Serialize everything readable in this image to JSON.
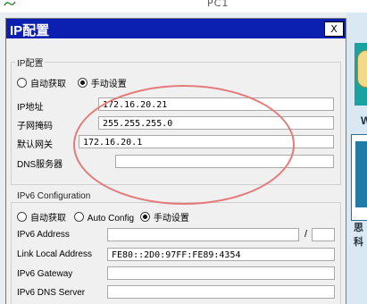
{
  "window": {
    "title": "PC1"
  },
  "dialog": {
    "title": "IP配置",
    "close_label": "X"
  },
  "ipv4": {
    "group_title": "IP配置",
    "modes": [
      "自动获取",
      "手动设置"
    ],
    "selected_mode": "手动设置",
    "fields": [
      {
        "label": "IP地址",
        "value": "172.16.20.21"
      },
      {
        "label": "子网掩码",
        "value": "255.255.255.0"
      },
      {
        "label": "默认网关",
        "value": "172.16.20.1"
      },
      {
        "label": "DNS服务器",
        "value": ""
      }
    ]
  },
  "ipv6": {
    "group_title": "IPv6 Configuration",
    "modes": [
      "自动获取",
      "Auto Config",
      "手动设置"
    ],
    "selected_mode": "手动设置",
    "address": {
      "label": "IPv6 Address",
      "value": "",
      "prefix": ""
    },
    "prefix_separator": "/",
    "link_local": {
      "label": "Link Local Address",
      "value": "FE80::2D0:97FF:FE89:4354"
    },
    "gateway": {
      "label": "IPv6 Gateway",
      "value": ""
    },
    "dns": {
      "label": "IPv6 DNS Server",
      "value": ""
    }
  },
  "background": {
    "right_letter": "W",
    "right_text": "思科"
  },
  "colors": {
    "titlebar": "#0b1fb0",
    "annotation": "#e47a7a"
  }
}
